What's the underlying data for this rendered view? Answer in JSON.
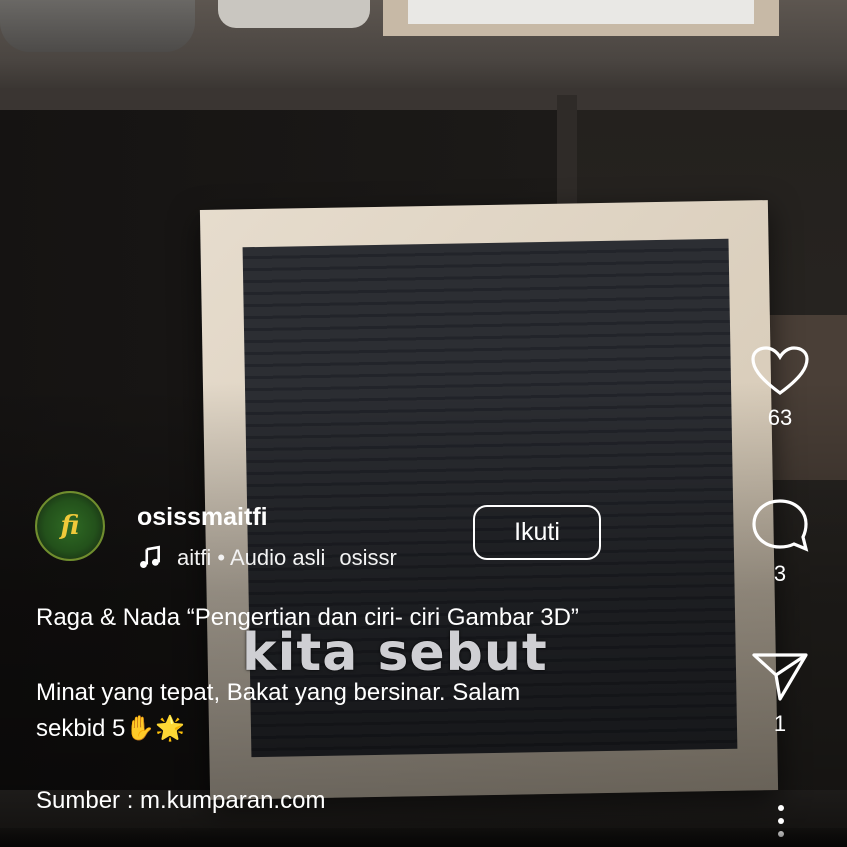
{
  "account": {
    "username": "osissmaitfi",
    "avatar_mark": "fi",
    "follow_label": "Ikuti"
  },
  "audio": {
    "icon": "music-note-icon",
    "source": "aitfi",
    "separator": "•",
    "label": "Audio asli",
    "extra": "osissr"
  },
  "caption": {
    "line1": "Raga & Nada “Pengertian dan ciri- ciri Gambar 3D”",
    "line2": "Minat yang tepat, Bakat yang bersinar. Salam",
    "line3": "sekbid 5✋🌟",
    "line4": "Sumber : m.kumparan.com"
  },
  "video_overlay_text": "kita sebut",
  "actions": {
    "like": {
      "icon": "heart-icon",
      "count": "63"
    },
    "comment": {
      "icon": "comment-icon",
      "count": "3"
    },
    "share": {
      "icon": "send-icon",
      "count": "1"
    },
    "more": {
      "icon": "more-vertical-icon"
    }
  },
  "colors": {
    "text": "#ffffff",
    "board": "#2c2e33",
    "frame": "#e6dccd",
    "avatar_green": "#2f6a24",
    "avatar_gold": "#f0c93a"
  }
}
